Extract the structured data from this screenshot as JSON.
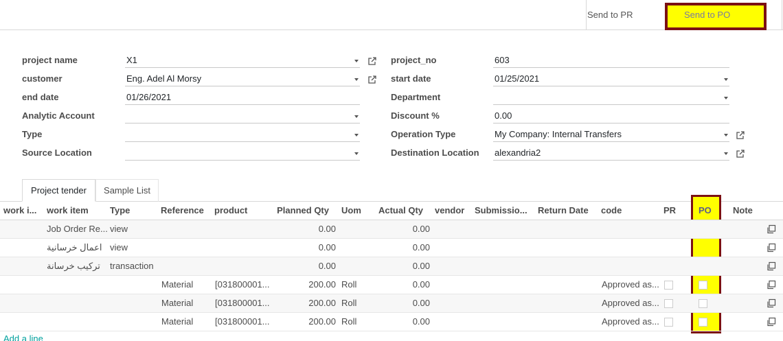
{
  "buttons": {
    "send_to_pr": "Send to PR",
    "send_to_po": "Send to PO"
  },
  "form": {
    "left": [
      {
        "label": "project name",
        "value": "X1"
      },
      {
        "label": "customer",
        "value": "Eng. Adel Al Morsy"
      },
      {
        "label": "end date",
        "value": "01/26/2021"
      },
      {
        "label": "Analytic Account",
        "value": ""
      },
      {
        "label": "Type",
        "value": ""
      },
      {
        "label": "Source Location",
        "value": ""
      }
    ],
    "right": [
      {
        "label": "project_no",
        "value": "603"
      },
      {
        "label": "start date",
        "value": "01/25/2021"
      },
      {
        "label": "Department",
        "value": ""
      },
      {
        "label": "Discount %",
        "value": "0.00"
      },
      {
        "label": "Operation Type",
        "value": "My Company: Internal Transfers"
      },
      {
        "label": "Destination Location",
        "value": "alexandria2"
      }
    ]
  },
  "tabs": [
    {
      "label": "Project tender",
      "active": true
    },
    {
      "label": "Sample List",
      "active": false
    }
  ],
  "table": {
    "headers": {
      "work_i": "work i...",
      "work_item": "work item",
      "type": "Type",
      "reference": "Reference",
      "product": "product",
      "planned_qty": "Planned Qty",
      "uom": "Uom",
      "actual_qty": "Actual Qty",
      "vendor": "vendor",
      "submission": "Submissio...",
      "return_date": "Return Date",
      "code": "code",
      "pr": "PR",
      "po": "PO",
      "note": "Note"
    },
    "rows": [
      {
        "work_item": "Job Order Re...",
        "type": "view",
        "reference": "",
        "product": "",
        "planned_qty": "0.00",
        "uom": "",
        "actual_qty": "0.00",
        "code": "",
        "checkboxes": false
      },
      {
        "work_item": "اعمال خرسانية",
        "type": "view",
        "reference": "",
        "product": "",
        "planned_qty": "0.00",
        "uom": "",
        "actual_qty": "0.00",
        "code": "",
        "checkboxes": false
      },
      {
        "work_item": "تركيب خرسانة",
        "type": "transaction",
        "reference": "",
        "product": "",
        "planned_qty": "0.00",
        "uom": "",
        "actual_qty": "0.00",
        "code": "",
        "checkboxes": false
      },
      {
        "work_item": "",
        "type": "",
        "reference": "Material",
        "product": "[031800001...",
        "planned_qty": "200.00",
        "uom": "Roll",
        "actual_qty": "0.00",
        "code": "Approved as...",
        "checkboxes": true
      },
      {
        "work_item": "",
        "type": "",
        "reference": "Material",
        "product": "[031800001...",
        "planned_qty": "200.00",
        "uom": "Roll",
        "actual_qty": "0.00",
        "code": "Approved as...",
        "checkboxes": true
      },
      {
        "work_item": "",
        "type": "",
        "reference": "Material",
        "product": "[031800001...",
        "planned_qty": "200.00",
        "uom": "Roll",
        "actual_qty": "0.00",
        "code": "Approved as...",
        "checkboxes": true
      }
    ],
    "add_line": "Add a line"
  },
  "colors": {
    "highlight": "#ffff00",
    "highlight_border": "#7b1113",
    "link": "#00a09d"
  },
  "icons": {
    "external_link": "external-link-icon",
    "dropdown": "caret-down-icon",
    "copy": "copy-icon"
  }
}
